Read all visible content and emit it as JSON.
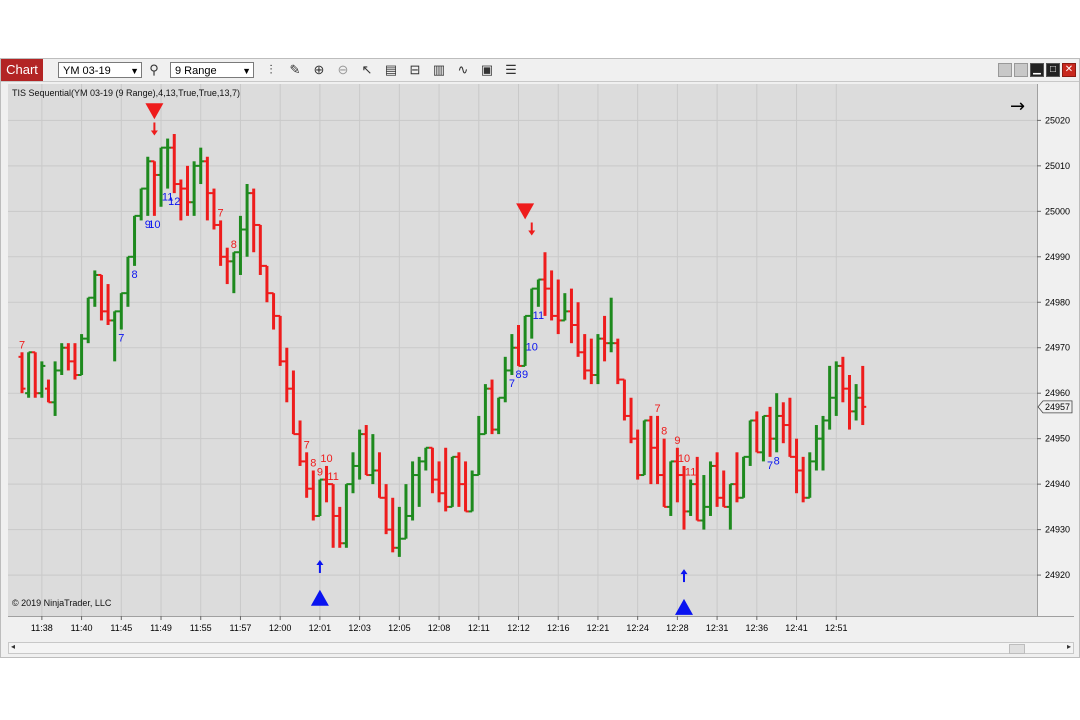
{
  "toolbar": {
    "chart_tab": "Chart",
    "instrument": "YM 03-19",
    "interval": "9 Range",
    "icons": [
      "search-icon",
      "bar-type-icon",
      "pencil-icon",
      "zoom-in-icon",
      "zoom-out-icon",
      "pointer-icon",
      "data-box-icon",
      "properties-icon",
      "indicator-icon",
      "strategy-icon",
      "template-icon",
      "list-icon"
    ],
    "window_controls": [
      "tile-icon",
      "tile-icon",
      "minimize-icon",
      "maximize-icon",
      "close-icon"
    ]
  },
  "chart_data": {
    "type": "ohlc",
    "indicator_label": "TIS Sequential(YM 03-19 (9 Range),4,13,True,True,13,7)",
    "copyright": "© 2019 NinjaTrader, LLC",
    "last_price": "24957",
    "ylim": [
      24911,
      25028
    ],
    "y_ticks": [
      24920,
      24930,
      24940,
      24950,
      24960,
      24970,
      24980,
      24990,
      25000,
      25010,
      25020
    ],
    "x_ticks": [
      {
        "bar": 3,
        "label": "11:38"
      },
      {
        "bar": 9,
        "label": "11:40"
      },
      {
        "bar": 15,
        "label": "11:45"
      },
      {
        "bar": 21,
        "label": "11:49"
      },
      {
        "bar": 27,
        "label": "11:55"
      },
      {
        "bar": 33,
        "label": "11:57"
      },
      {
        "bar": 39,
        "label": "12:00"
      },
      {
        "bar": 45,
        "label": "12:01"
      },
      {
        "bar": 51,
        "label": "12:03"
      },
      {
        "bar": 57,
        "label": "12:05"
      },
      {
        "bar": 63,
        "label": "12:08"
      },
      {
        "bar": 69,
        "label": "12:11"
      },
      {
        "bar": 75,
        "label": "12:12"
      },
      {
        "bar": 81,
        "label": "12:16"
      },
      {
        "bar": 87,
        "label": "12:21"
      },
      {
        "bar": 93,
        "label": "12:24"
      },
      {
        "bar": 99,
        "label": "12:28"
      },
      {
        "bar": 105,
        "label": "12:31"
      },
      {
        "bar": 111,
        "label": "12:36"
      },
      {
        "bar": 117,
        "label": "12:41"
      },
      {
        "bar": 123,
        "label": "12:51"
      }
    ],
    "colors": {
      "up": "#1e8a1e",
      "down": "#ee1c1c",
      "buy": "#0a14f0",
      "sell": "#ee1c1c",
      "background": "#dcdcdc"
    },
    "bars": [
      [
        24968,
        24961,
        24960,
        24969
      ],
      [
        24960,
        24969,
        24959,
        24969
      ],
      [
        24969,
        24960,
        24959,
        24969
      ],
      [
        24960,
        24966,
        24959,
        24967
      ],
      [
        24961,
        24958,
        24958,
        24963
      ],
      [
        24958,
        24965,
        24955,
        24967
      ],
      [
        24965,
        24970,
        24964,
        24971
      ],
      [
        24970,
        24967,
        24965,
        24971
      ],
      [
        24967,
        24964,
        24963,
        24971
      ],
      [
        24964,
        24972,
        24964,
        24973
      ],
      [
        24972,
        24981,
        24971,
        24981
      ],
      [
        24981,
        24986,
        24979,
        24987
      ],
      [
        24986,
        24978,
        24976,
        24986
      ],
      [
        24978,
        24976,
        24975,
        24984
      ],
      [
        24976,
        24978,
        24967,
        24978
      ],
      [
        24978,
        24982,
        24974,
        24982
      ],
      [
        24982,
        24990,
        24979,
        24990
      ],
      [
        24990,
        24999,
        24988,
        24999
      ],
      [
        24999,
        25005,
        24998,
        25005
      ],
      [
        25005,
        25011,
        24999,
        25012
      ],
      [
        25011,
        25008,
        24999,
        25011
      ],
      [
        25008,
        25014,
        25001,
        25014
      ],
      [
        25014,
        25014,
        25005,
        25016
      ],
      [
        25014,
        25006,
        25004,
        25017
      ],
      [
        25006,
        25005,
        24998,
        25007
      ],
      [
        25005,
        25002,
        24999,
        25010
      ],
      [
        25002,
        25010,
        24999,
        25011
      ],
      [
        25010,
        25011,
        25006,
        25014
      ],
      [
        25011,
        25004,
        24998,
        25012
      ],
      [
        25004,
        24997,
        24996,
        25005
      ],
      [
        24997,
        24990,
        24988,
        24998
      ],
      [
        24990,
        24989,
        24984,
        24992
      ],
      [
        24989,
        24991,
        24982,
        24991
      ],
      [
        24991,
        24996,
        24986,
        24999
      ],
      [
        24996,
        25004,
        24990,
        25006
      ],
      [
        25004,
        24997,
        24991,
        25005
      ],
      [
        24997,
        24988,
        24986,
        24997
      ],
      [
        24988,
        24982,
        24980,
        24988
      ],
      [
        24982,
        24977,
        24974,
        24982
      ],
      [
        24977,
        24967,
        24966,
        24977
      ],
      [
        24967,
        24961,
        24958,
        24970
      ],
      [
        24961,
        24951,
        24951,
        24965
      ],
      [
        24951,
        24945,
        24944,
        24954
      ],
      [
        24945,
        24939,
        24937,
        24947
      ],
      [
        24939,
        24933,
        24932,
        24943
      ],
      [
        24933,
        24941,
        24933,
        24941
      ],
      [
        24941,
        24940,
        24936,
        24944
      ],
      [
        24940,
        24933,
        24926,
        24940
      ],
      [
        24933,
        24927,
        24926,
        24935
      ],
      [
        24927,
        24940,
        24926,
        24940
      ],
      [
        24940,
        24944,
        24938,
        24947
      ],
      [
        24944,
        24951,
        24941,
        24952
      ],
      [
        24951,
        24942,
        24942,
        24953
      ],
      [
        24942,
        24943,
        24940,
        24951
      ],
      [
        24943,
        24937,
        24937,
        24947
      ],
      [
        24937,
        24930,
        24929,
        24940
      ],
      [
        24930,
        24926,
        24925,
        24937
      ],
      [
        24926,
        24928,
        24924,
        24935
      ],
      [
        24928,
        24933,
        24928,
        24940
      ],
      [
        24933,
        24942,
        24932,
        24945
      ],
      [
        24942,
        24945,
        24935,
        24946
      ],
      [
        24945,
        24948,
        24943,
        24948
      ],
      [
        24948,
        24941,
        24938,
        24948
      ],
      [
        24941,
        24938,
        24936,
        24945
      ],
      [
        24938,
        24935,
        24934,
        24948
      ],
      [
        24935,
        24946,
        24935,
        24946
      ],
      [
        24946,
        24940,
        24935,
        24947
      ],
      [
        24940,
        24934,
        24934,
        24945
      ],
      [
        24934,
        24942,
        24934,
        24943
      ],
      [
        24942,
        24951,
        24942,
        24955
      ],
      [
        24951,
        24961,
        24951,
        24962
      ],
      [
        24961,
        24952,
        24951,
        24963
      ],
      [
        24952,
        24959,
        24951,
        24959
      ],
      [
        24959,
        24965,
        24958,
        24968
      ],
      [
        24965,
        24970,
        24964,
        24973
      ],
      [
        24970,
        24966,
        24966,
        24975
      ],
      [
        24966,
        24977,
        24966,
        24977
      ],
      [
        24977,
        24983,
        24972,
        24983
      ],
      [
        24983,
        24985,
        24979,
        24985
      ],
      [
        24985,
        24983,
        24977,
        24991
      ],
      [
        24983,
        24977,
        24976,
        24987
      ],
      [
        24977,
        24976,
        24973,
        24985
      ],
      [
        24976,
        24978,
        24976,
        24982
      ],
      [
        24978,
        24975,
        24971,
        24983
      ],
      [
        24975,
        24969,
        24968,
        24980
      ],
      [
        24969,
        24965,
        24963,
        24973
      ],
      [
        24965,
        24964,
        24962,
        24972
      ],
      [
        24964,
        24972,
        24962,
        24973
      ],
      [
        24972,
        24971,
        24967,
        24977
      ],
      [
        24971,
        24971,
        24969,
        24981
      ],
      [
        24971,
        24963,
        24962,
        24972
      ],
      [
        24963,
        24955,
        24954,
        24963
      ],
      [
        24955,
        24950,
        24949,
        24959
      ],
      [
        24950,
        24942,
        24941,
        24952
      ],
      [
        24942,
        24954,
        24942,
        24954
      ],
      [
        24954,
        24948,
        24940,
        24955
      ],
      [
        24948,
        24942,
        24940,
        24955
      ],
      [
        24942,
        24935,
        24935,
        24950
      ],
      [
        24935,
        24945,
        24933,
        24945
      ],
      [
        24945,
        24942,
        24936,
        24948
      ],
      [
        24942,
        24934,
        24930,
        24944
      ],
      [
        24934,
        24940,
        24933,
        24941
      ],
      [
        24940,
        24932,
        24932,
        24946
      ],
      [
        24932,
        24935,
        24930,
        24942
      ],
      [
        24935,
        24944,
        24933,
        24945
      ],
      [
        24944,
        24937,
        24935,
        24947
      ],
      [
        24937,
        24935,
        24935,
        24943
      ],
      [
        24935,
        24940,
        24930,
        24940
      ],
      [
        24940,
        24937,
        24936,
        24947
      ],
      [
        24937,
        24946,
        24937,
        24946
      ],
      [
        24946,
        24954,
        24944,
        24954
      ],
      [
        24954,
        24947,
        24947,
        24956
      ],
      [
        24947,
        24955,
        24945,
        24955
      ],
      [
        24955,
        24950,
        24946,
        24957
      ],
      [
        24950,
        24955,
        24947,
        24960
      ],
      [
        24955,
        24953,
        24949,
        24958
      ],
      [
        24953,
        24946,
        24946,
        24959
      ],
      [
        24946,
        24943,
        24938,
        24950
      ],
      [
        24943,
        24937,
        24936,
        24946
      ],
      [
        24937,
        24945,
        24937,
        24947
      ],
      [
        24945,
        24950,
        24943,
        24953
      ],
      [
        24950,
        24954,
        24943,
        24955
      ],
      [
        24954,
        24959,
        24952,
        24966
      ],
      [
        24959,
        24966,
        24955,
        24967
      ],
      [
        24966,
        24961,
        24958,
        24968
      ],
      [
        24961,
        24956,
        24952,
        24964
      ],
      [
        24956,
        24959,
        24954,
        24962
      ],
      [
        24959,
        24957,
        24953,
        24966
      ]
    ],
    "annotations": [
      {
        "bar": 0,
        "text": "7",
        "position": "above",
        "color": "sell"
      },
      {
        "bar": 15,
        "text": "7",
        "position": "below",
        "color": "buy"
      },
      {
        "bar": 17,
        "text": "8",
        "position": "below",
        "color": "buy"
      },
      {
        "bar": 19,
        "text": "9",
        "position": "below",
        "color": "buy"
      },
      {
        "bar": 20,
        "text": "10",
        "position": "below",
        "color": "buy"
      },
      {
        "bar": 22,
        "text": "11",
        "position": "below",
        "color": "buy"
      },
      {
        "bar": 23,
        "text": "12",
        "position": "below",
        "color": "buy"
      },
      {
        "bar": 30,
        "text": "7",
        "position": "above",
        "color": "sell"
      },
      {
        "bar": 32,
        "text": "8",
        "position": "above",
        "color": "sell"
      },
      {
        "bar": 43,
        "text": "7",
        "position": "above",
        "color": "sell"
      },
      {
        "bar": 44,
        "text": "8",
        "position": "above",
        "color": "sell"
      },
      {
        "bar": 45,
        "text": "9",
        "position": "above",
        "color": "sell"
      },
      {
        "bar": 46,
        "text": "10",
        "position": "above",
        "color": "sell"
      },
      {
        "bar": 47,
        "text": "11",
        "position": "above",
        "color": "sell"
      },
      {
        "bar": 74,
        "text": "7",
        "position": "below",
        "color": "buy"
      },
      {
        "bar": 75,
        "text": "8",
        "position": "below",
        "color": "buy"
      },
      {
        "bar": 76,
        "text": "9",
        "position": "below",
        "color": "buy"
      },
      {
        "bar": 77,
        "text": "10",
        "position": "below",
        "color": "buy"
      },
      {
        "bar": 78,
        "text": "11",
        "position": "below",
        "color": "buy"
      },
      {
        "bar": 96,
        "text": "7",
        "position": "above",
        "color": "sell"
      },
      {
        "bar": 97,
        "text": "8",
        "position": "above",
        "color": "sell"
      },
      {
        "bar": 99,
        "text": "9",
        "position": "above",
        "color": "sell"
      },
      {
        "bar": 100,
        "text": "10",
        "position": "above",
        "color": "sell"
      },
      {
        "bar": 101,
        "text": "11",
        "position": "above",
        "color": "sell"
      },
      {
        "bar": 113,
        "text": "7",
        "position": "below",
        "color": "buy"
      },
      {
        "bar": 114,
        "text": "8",
        "position": "below",
        "color": "buy"
      }
    ],
    "signals": [
      {
        "bar": 20,
        "type": "sell-triangle",
        "price": 25022
      },
      {
        "bar": 20,
        "type": "sell-arrow",
        "price": 25018
      },
      {
        "bar": 76,
        "type": "sell-triangle",
        "price": 25000
      },
      {
        "bar": 77,
        "type": "sell-arrow",
        "price": 24996
      },
      {
        "bar": 45,
        "type": "buy-arrow",
        "price": 24922
      },
      {
        "bar": 45,
        "type": "buy-triangle",
        "price": 24915
      },
      {
        "bar": 100,
        "type": "buy-arrow",
        "price": 24920
      },
      {
        "bar": 100,
        "type": "buy-triangle",
        "price": 24913
      }
    ]
  }
}
